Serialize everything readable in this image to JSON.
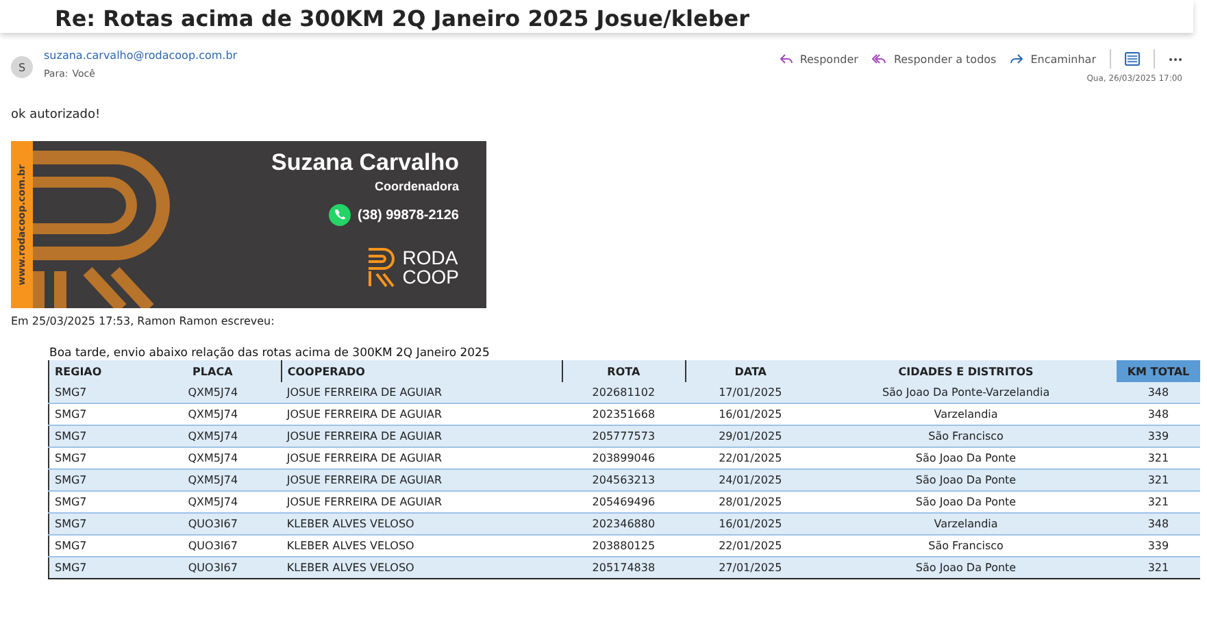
{
  "subject": "Re: Rotas acima de 300KM 2Q Janeiro 2025 Josue/kleber",
  "message": {
    "avatar": "S",
    "sender": "suzana.carvalho@rodacoop.com.br",
    "to_label": "Para:",
    "to": "Você",
    "actions": [
      {
        "kind": "reply",
        "label": "Responder"
      },
      {
        "kind": "reply_all",
        "label": "Responder a todos"
      },
      {
        "kind": "forward",
        "label": "Encaminhar"
      }
    ],
    "date": "Qua, 26/03/2025 17:00",
    "body": "ok autorizado!",
    "signature": {
      "site": "www.rodacoop.com.br",
      "name": "Suzana Carvalho",
      "role": "Coordenadora",
      "phone": "(38) 99878-2126",
      "logo_top": "RODA",
      "logo_bottom": "COOP"
    },
    "quote_header": "Em 25/03/2025 17:53, Ramon Ramon escreveu:",
    "intro": "Boa tarde, envio abaixo relação das rotas acima de  300KM 2Q Janeiro 2025",
    "table": {
      "columns": [
        "REGIAO",
        "PLACA",
        "COOPERADO",
        "ROTA",
        "DATA",
        "CIDADES E DISTRITOS",
        "KM TOTAL"
      ],
      "rows": [
        [
          "SMG7",
          "QXM5J74",
          "JOSUE FERREIRA DE AGUIAR",
          "202681102",
          "17/01/2025",
          "São Joao Da Ponte-Varzelandia",
          "348"
        ],
        [
          "SMG7",
          "QXM5J74",
          "JOSUE FERREIRA DE AGUIAR",
          "202351668",
          "16/01/2025",
          "Varzelandia",
          "348"
        ],
        [
          "SMG7",
          "QXM5J74",
          "JOSUE FERREIRA DE AGUIAR",
          "205777573",
          "29/01/2025",
          "São Francisco",
          "339"
        ],
        [
          "SMG7",
          "QXM5J74",
          "JOSUE FERREIRA DE AGUIAR",
          "203899046",
          "22/01/2025",
          "São Joao Da Ponte",
          "321"
        ],
        [
          "SMG7",
          "QXM5J74",
          "JOSUE FERREIRA DE AGUIAR",
          "204563213",
          "24/01/2025",
          "São Joao Da Ponte",
          "321"
        ],
        [
          "SMG7",
          "QXM5J74",
          "JOSUE FERREIRA DE AGUIAR",
          "205469496",
          "28/01/2025",
          "São Joao Da Ponte",
          "321"
        ],
        [
          "SMG7",
          "QUO3I67",
          "KLEBER ALVES VELOSO",
          "202346880",
          "16/01/2025",
          "Varzelandia",
          "348"
        ],
        [
          "SMG7",
          "QUO3I67",
          "KLEBER ALVES VELOSO",
          "203880125",
          "22/01/2025",
          "São Francisco",
          "339"
        ],
        [
          "SMG7",
          "QUO3I67",
          "KLEBER ALVES VELOSO",
          "205174838",
          "27/01/2025",
          "São Joao Da Ponte",
          "321"
        ]
      ]
    }
  }
}
